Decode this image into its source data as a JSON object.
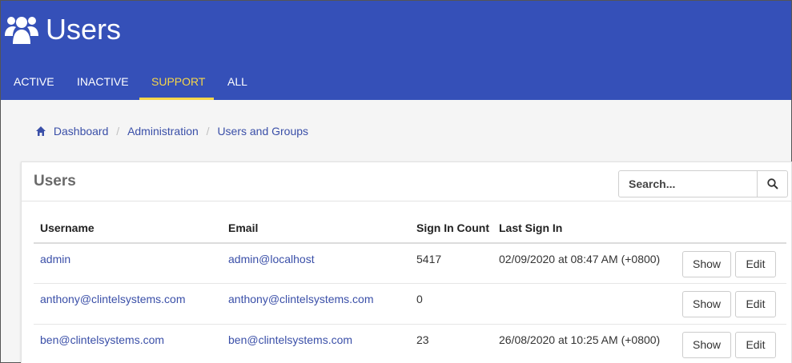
{
  "header": {
    "title": "Users",
    "icon": "users-icon",
    "background": "#3550b8",
    "active_tab_color": "#f5d64a"
  },
  "tabs": [
    {
      "label": "ACTIVE",
      "active": false
    },
    {
      "label": "INACTIVE",
      "active": false
    },
    {
      "label": "SUPPORT",
      "active": true
    },
    {
      "label": "ALL",
      "active": false
    }
  ],
  "breadcrumb": {
    "home_icon": "home-icon",
    "items": [
      "Dashboard",
      "Administration",
      "Users and Groups"
    ],
    "separator": "/"
  },
  "panel": {
    "title": "Users",
    "search": {
      "placeholder": "Search...",
      "value": "",
      "icon": "search-icon"
    }
  },
  "table": {
    "headers": [
      "Username",
      "Email",
      "Sign In Count",
      "Last Sign In"
    ],
    "rows": [
      {
        "username": "admin",
        "email": "admin@localhost",
        "sign_in_count": "5417",
        "last_sign_in": "02/09/2020 at 08:47 AM (+0800)",
        "show_label": "Show",
        "edit_label": "Edit"
      },
      {
        "username": "anthony@clintelsystems.com",
        "email": "anthony@clintelsystems.com",
        "sign_in_count": "0",
        "last_sign_in": "",
        "show_label": "Show",
        "edit_label": "Edit"
      },
      {
        "username": "ben@clintelsystems.com",
        "email": "ben@clintelsystems.com",
        "sign_in_count": "23",
        "last_sign_in": "26/08/2020 at 10:25 AM (+0800)",
        "show_label": "Show",
        "edit_label": "Edit"
      }
    ]
  },
  "colors": {
    "link": "#3a4fa8"
  }
}
